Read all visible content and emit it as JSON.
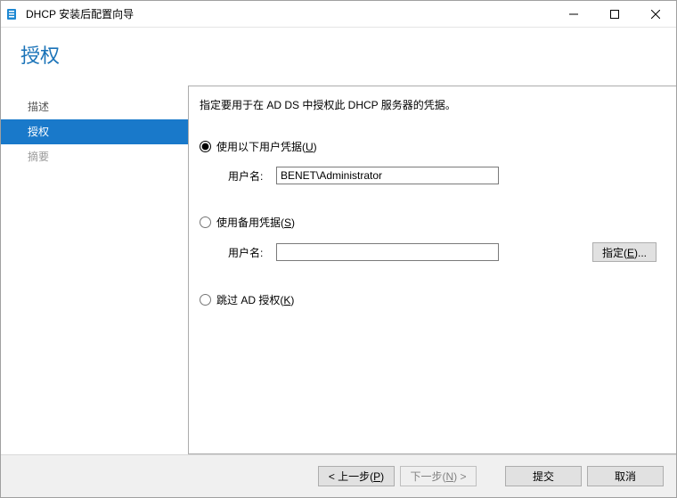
{
  "window": {
    "title": "DHCP 安装后配置向导"
  },
  "heading": "授权",
  "sidebar": {
    "items": [
      {
        "label": "描述",
        "state": "normal"
      },
      {
        "label": "授权",
        "state": "selected"
      },
      {
        "label": "摘要",
        "state": "dim"
      }
    ]
  },
  "content": {
    "instruction": "指定要用于在 AD DS 中授权此 DHCP 服务器的凭据。",
    "option1": {
      "label_pre": "使用以下用户凭据(",
      "mnemonic": "U",
      "label_post": ")",
      "user_label": "用户名:",
      "user_value": "BENET\\Administrator",
      "checked": true
    },
    "option2": {
      "label_pre": "使用备用凭据(",
      "mnemonic": "S",
      "label_post": ")",
      "user_label": "用户名:",
      "user_value": "",
      "specify_pre": "指定(",
      "specify_mn": "E",
      "specify_post": ")...",
      "checked": false
    },
    "option3": {
      "label_pre": "跳过 AD 授权(",
      "mnemonic": "K",
      "label_post": ")",
      "checked": false
    }
  },
  "footer": {
    "prev_pre": "< 上一步(",
    "prev_mn": "P",
    "prev_post": ")",
    "next_pre": "下一步(",
    "next_mn": "N",
    "next_post": ") >",
    "commit": "提交",
    "cancel": "取消"
  }
}
